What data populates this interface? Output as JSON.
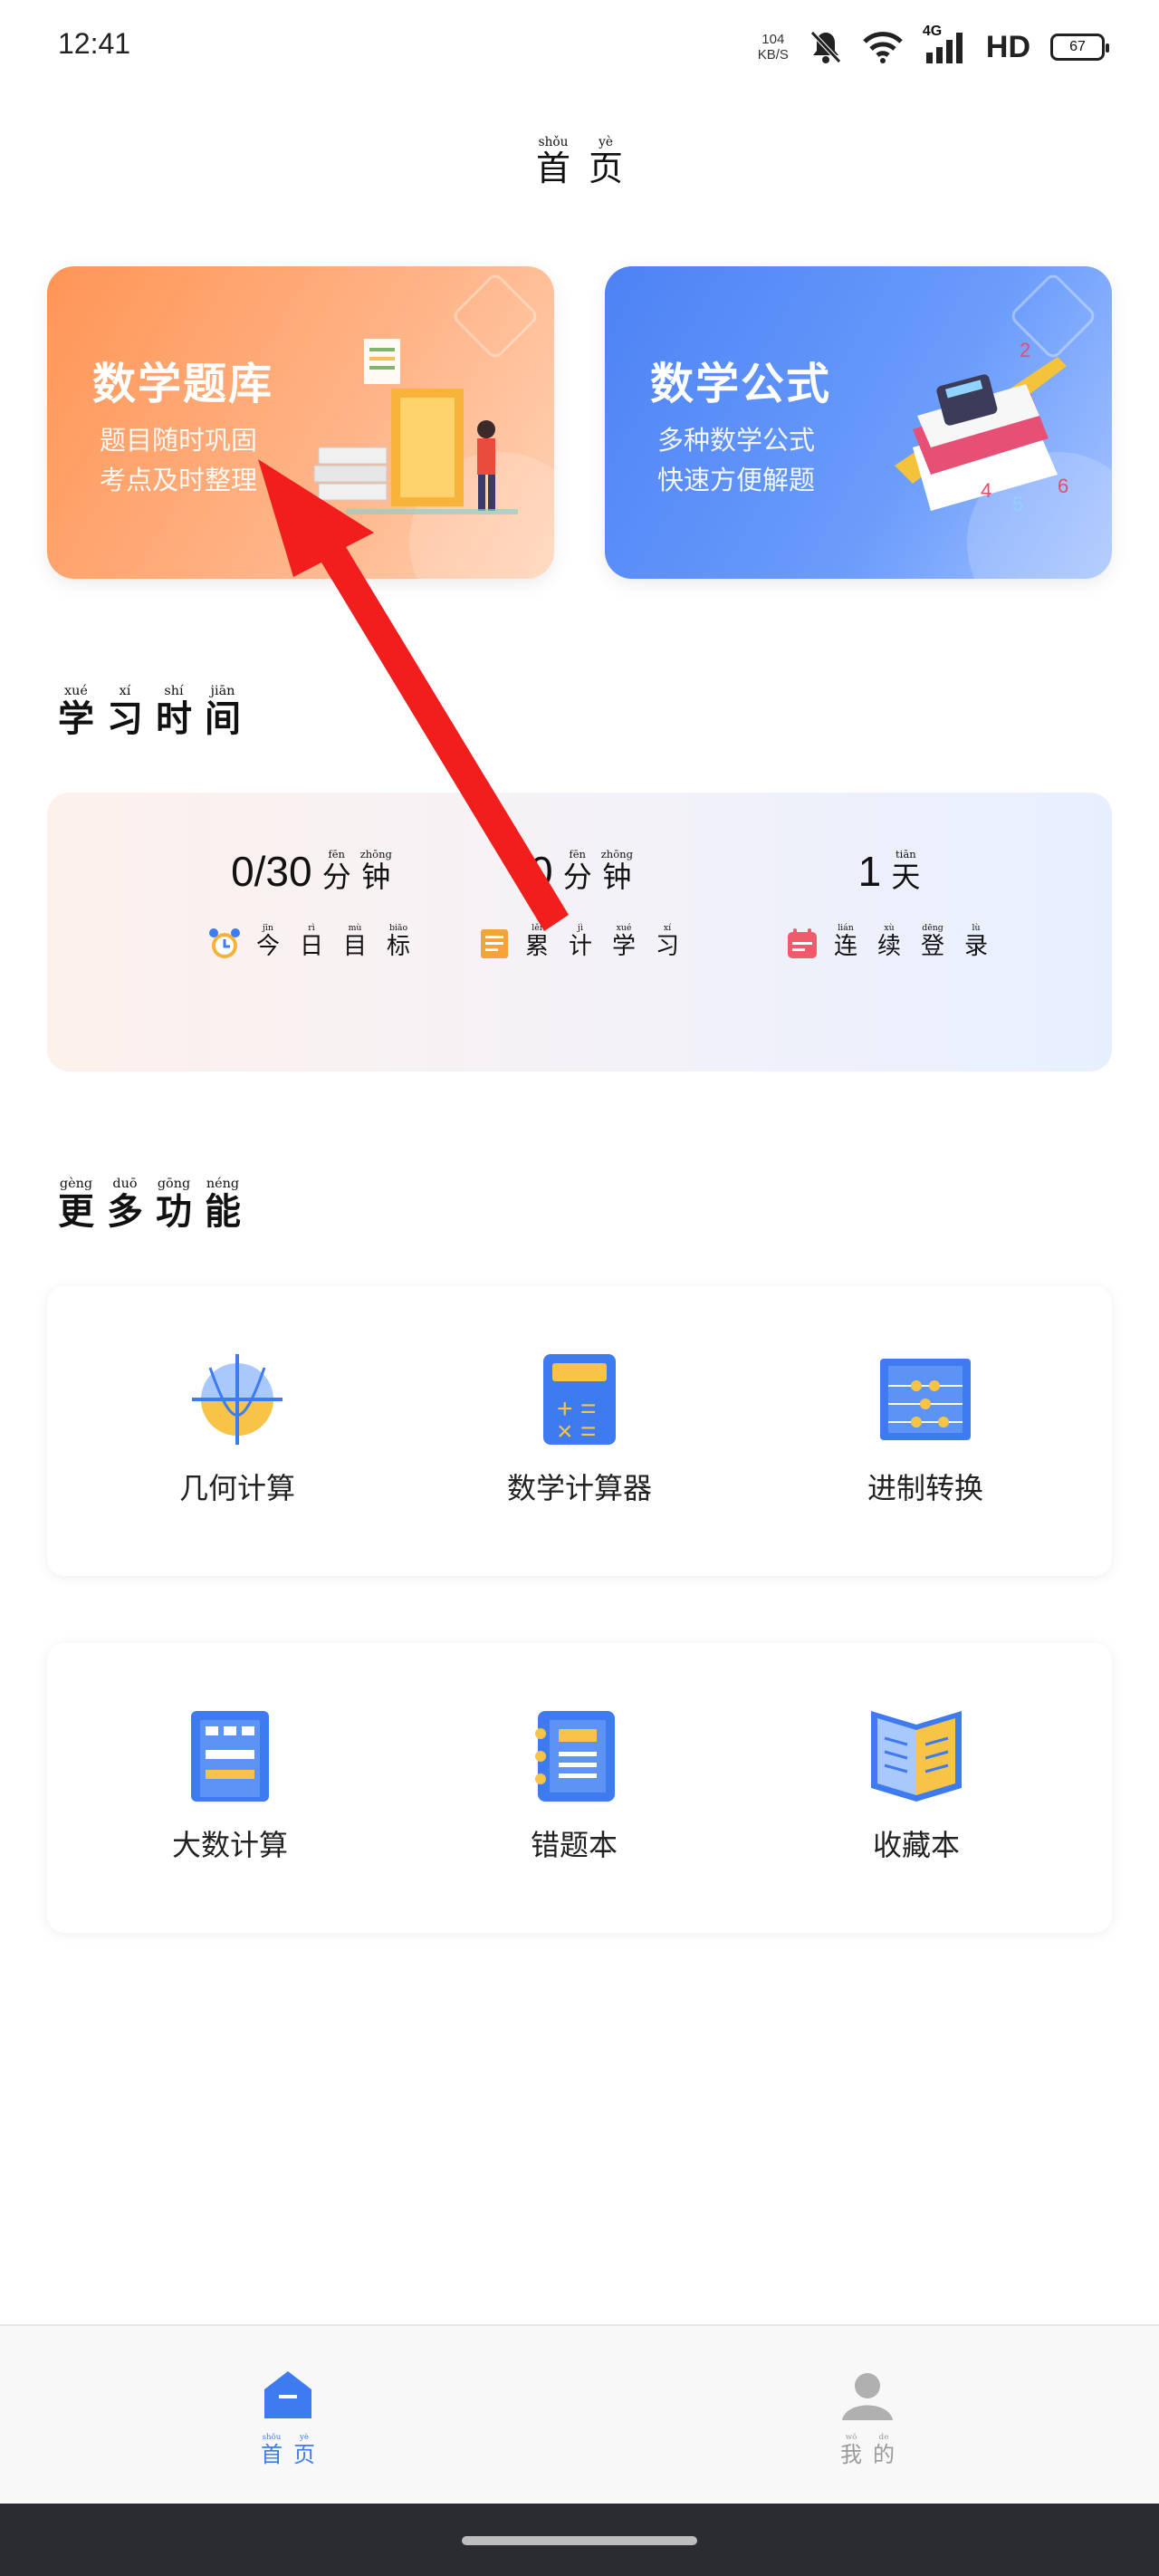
{
  "status_bar": {
    "time": "12:41",
    "net_speed": "104",
    "net_unit": "KB/S",
    "network": "4G",
    "hd": "HD",
    "battery": "67"
  },
  "header": {
    "title": [
      {
        "char": "首",
        "pinyin": "shǒu"
      },
      {
        "char": "页",
        "pinyin": "yè"
      }
    ]
  },
  "cards": [
    {
      "title": "数学题库",
      "lines": [
        "题目随时巩固",
        "考点及时整理"
      ],
      "color": "#ff9556"
    },
    {
      "title": "数学公式",
      "lines": [
        "多种数学公式",
        "快速方便解题"
      ],
      "color": "#4d82f5"
    }
  ],
  "study_section": {
    "title": [
      {
        "char": "学",
        "pinyin": "xué"
      },
      {
        "char": "习",
        "pinyin": "xí"
      },
      {
        "char": "时",
        "pinyin": "shí"
      },
      {
        "char": "间",
        "pinyin": "jiān"
      }
    ],
    "stats": [
      {
        "value": "0/30",
        "unit": [
          {
            "char": "分",
            "pinyin": "fēn"
          },
          {
            "char": "钟",
            "pinyin": "zhōng"
          }
        ],
        "label": [
          {
            "char": "今",
            "pinyin": "jīn"
          },
          {
            "char": "日",
            "pinyin": "rì"
          },
          {
            "char": "目",
            "pinyin": "mù"
          },
          {
            "char": "标",
            "pinyin": "biāo"
          }
        ],
        "icon": "alarm-clock-icon"
      },
      {
        "value": "0",
        "unit": [
          {
            "char": "分",
            "pinyin": "fēn"
          },
          {
            "char": "钟",
            "pinyin": "zhōng"
          }
        ],
        "label": [
          {
            "char": "累",
            "pinyin": "lěi"
          },
          {
            "char": "计",
            "pinyin": "jì"
          },
          {
            "char": "学",
            "pinyin": "xué"
          },
          {
            "char": "习",
            "pinyin": "xí"
          }
        ],
        "icon": "scroll-icon"
      },
      {
        "value": "1",
        "unit": [
          {
            "char": "天",
            "pinyin": "tiān"
          }
        ],
        "label": [
          {
            "char": "连",
            "pinyin": "lián"
          },
          {
            "char": "续",
            "pinyin": "xù"
          },
          {
            "char": "登",
            "pinyin": "dēng"
          },
          {
            "char": "录",
            "pinyin": "lù"
          }
        ],
        "icon": "calendar-icon"
      }
    ]
  },
  "more_section": {
    "title": [
      {
        "char": "更",
        "pinyin": "gèng"
      },
      {
        "char": "多",
        "pinyin": "duō"
      },
      {
        "char": "功",
        "pinyin": "gōng"
      },
      {
        "char": "能",
        "pinyin": "néng"
      }
    ],
    "row1": [
      {
        "label": "几何计算",
        "icon": "geometry-graph-icon"
      },
      {
        "label": "数学计算器",
        "icon": "calculator-icon"
      },
      {
        "label": "进制转换",
        "icon": "abacus-icon"
      }
    ],
    "row2": [
      {
        "label": "大数计算",
        "icon": "big-number-icon"
      },
      {
        "label": "错题本",
        "icon": "notebook-icon"
      },
      {
        "label": "收藏本",
        "icon": "open-book-icon"
      }
    ]
  },
  "bottom_nav": [
    {
      "label": [
        {
          "char": "首",
          "pinyin": "shǒu"
        },
        {
          "char": "页",
          "pinyin": "yè"
        }
      ],
      "active": true,
      "color": "#3e7bf0"
    },
    {
      "label": [
        {
          "char": "我",
          "pinyin": "wǒ"
        },
        {
          "char": "的",
          "pinyin": "de"
        }
      ],
      "active": false,
      "color": "#9a9a9a"
    }
  ]
}
